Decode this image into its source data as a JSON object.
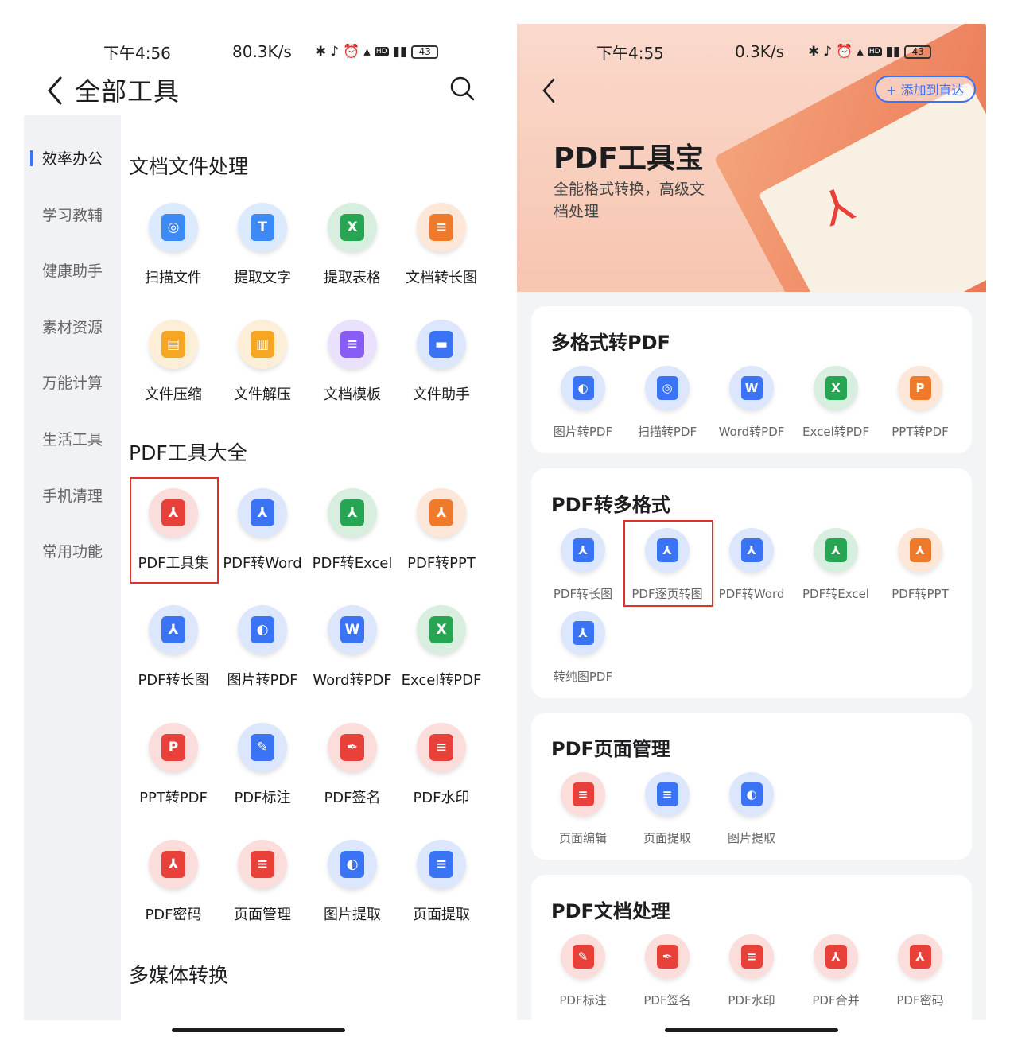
{
  "left": {
    "status": {
      "time": "下午4:56",
      "net": "80.3K/s",
      "battery": "43"
    },
    "title": "全部工具",
    "sidebar": [
      {
        "label": "效率办公"
      },
      {
        "label": "学习教辅"
      },
      {
        "label": "健康助手"
      },
      {
        "label": "素材资源"
      },
      {
        "label": "万能计算"
      },
      {
        "label": "生活工具"
      },
      {
        "label": "手机清理"
      },
      {
        "label": "常用功能"
      }
    ],
    "sections": [
      {
        "title": "文档文件处理",
        "tools": [
          {
            "label": "扫描文件",
            "icon": "scan-icon",
            "color": "#3b8af5",
            "glyph": "◎"
          },
          {
            "label": "提取文字",
            "icon": "text-extract-icon",
            "color": "#3b8af5",
            "glyph": "T"
          },
          {
            "label": "提取表格",
            "icon": "excel-icon",
            "color": "#27a552",
            "glyph": "X"
          },
          {
            "label": "文档转长图",
            "icon": "doc-image-icon",
            "color": "#f07a2c",
            "glyph": "≡"
          },
          {
            "label": "文件压缩",
            "icon": "zip-icon",
            "color": "#f5a623",
            "glyph": "▤"
          },
          {
            "label": "文件解压",
            "icon": "unzip-icon",
            "color": "#f5a623",
            "glyph": "▥"
          },
          {
            "label": "文档模板",
            "icon": "template-icon",
            "color": "#8a5cf6",
            "glyph": "≡"
          },
          {
            "label": "文件助手",
            "icon": "folder-icon",
            "color": "#3b73f5",
            "glyph": "▬"
          }
        ]
      },
      {
        "title": "PDF工具大全",
        "tools": [
          {
            "label": "PDF工具集",
            "icon": "pdf-toolkit-icon",
            "color": "#e8413a",
            "glyph": "⅄"
          },
          {
            "label": "PDF转Word",
            "icon": "pdf-word-icon",
            "color": "#3b73f5",
            "glyph": "⅄"
          },
          {
            "label": "PDF转Excel",
            "icon": "pdf-excel-icon",
            "color": "#27a552",
            "glyph": "⅄"
          },
          {
            "label": "PDF转PPT",
            "icon": "pdf-ppt-icon",
            "color": "#f07a2c",
            "glyph": "⅄"
          },
          {
            "label": "PDF转长图",
            "icon": "pdf-longimage-icon",
            "color": "#3b73f5",
            "glyph": "⅄"
          },
          {
            "label": "图片转PDF",
            "icon": "image-pdf-icon",
            "color": "#3b73f5",
            "glyph": "◐"
          },
          {
            "label": "Word转PDF",
            "icon": "word-pdf-icon",
            "color": "#3b73f5",
            "glyph": "W"
          },
          {
            "label": "Excel转PDF",
            "icon": "excel-pdf-icon",
            "color": "#27a552",
            "glyph": "X"
          },
          {
            "label": "PPT转PDF",
            "icon": "ppt-pdf-icon",
            "color": "#e8413a",
            "glyph": "P"
          },
          {
            "label": "PDF标注",
            "icon": "annotate-icon",
            "color": "#3b73f5",
            "glyph": "✎"
          },
          {
            "label": "PDF签名",
            "icon": "signature-icon",
            "color": "#e8413a",
            "glyph": "✒"
          },
          {
            "label": "PDF水印",
            "icon": "watermark-icon",
            "color": "#e8413a",
            "glyph": "≡"
          },
          {
            "label": "PDF密码",
            "icon": "password-icon",
            "color": "#e8413a",
            "glyph": "⅄"
          },
          {
            "label": "页面管理",
            "icon": "page-manage-icon",
            "color": "#e8413a",
            "glyph": "≡"
          },
          {
            "label": "图片提取",
            "icon": "image-extract-icon",
            "color": "#3b73f5",
            "glyph": "◐"
          },
          {
            "label": "页面提取",
            "icon": "page-extract-icon",
            "color": "#3b73f5",
            "glyph": "≡"
          }
        ]
      },
      {
        "title": "多媒体转换",
        "tools": []
      }
    ]
  },
  "right": {
    "status": {
      "time": "下午4:55",
      "net": "0.3K/s",
      "battery": "43"
    },
    "add_button": "+ 添加到直达",
    "hero_title": "PDF工具宝",
    "hero_subtitle": "全能格式转换，高级文档处理",
    "cards": [
      {
        "title": "多格式转PDF",
        "tools": [
          {
            "label": "图片转PDF",
            "icon": "image-pdf-icon",
            "color": "#3b73f5",
            "glyph": "◐"
          },
          {
            "label": "扫描转PDF",
            "icon": "scan-pdf-icon",
            "color": "#3b73f5",
            "glyph": "◎"
          },
          {
            "label": "Word转PDF",
            "icon": "word-pdf-icon",
            "color": "#3b73f5",
            "glyph": "W"
          },
          {
            "label": "Excel转PDF",
            "icon": "excel-pdf-icon",
            "color": "#27a552",
            "glyph": "X"
          },
          {
            "label": "PPT转PDF",
            "icon": "ppt-pdf-icon",
            "color": "#f07a2c",
            "glyph": "P"
          }
        ]
      },
      {
        "title": "PDF转多格式",
        "tools": [
          {
            "label": "PDF转长图",
            "icon": "pdf-longimage-icon",
            "color": "#3b73f5",
            "glyph": "⅄"
          },
          {
            "label": "PDF逐页转图",
            "icon": "pdf-page-image-icon",
            "color": "#3b73f5",
            "glyph": "⅄"
          },
          {
            "label": "PDF转Word",
            "icon": "pdf-word-icon",
            "color": "#3b73f5",
            "glyph": "⅄"
          },
          {
            "label": "PDF转Excel",
            "icon": "pdf-excel-icon",
            "color": "#27a552",
            "glyph": "⅄"
          },
          {
            "label": "PDF转PPT",
            "icon": "pdf-ppt-icon",
            "color": "#f07a2c",
            "glyph": "⅄"
          },
          {
            "label": "转纯图PDF",
            "icon": "pure-image-pdf-icon",
            "color": "#3b73f5",
            "glyph": "⅄"
          }
        ]
      },
      {
        "title": "PDF页面管理",
        "tools": [
          {
            "label": "页面编辑",
            "icon": "page-edit-icon",
            "color": "#e8413a",
            "glyph": "≡"
          },
          {
            "label": "页面提取",
            "icon": "page-extract-icon",
            "color": "#3b73f5",
            "glyph": "≡"
          },
          {
            "label": "图片提取",
            "icon": "image-extract-icon",
            "color": "#3b73f5",
            "glyph": "◐"
          }
        ]
      },
      {
        "title": "PDF文档处理",
        "tools": [
          {
            "label": "PDF标注",
            "icon": "annotate-icon",
            "color": "#e8413a",
            "glyph": "✎"
          },
          {
            "label": "PDF签名",
            "icon": "signature-icon",
            "color": "#e8413a",
            "glyph": "✒"
          },
          {
            "label": "PDF水印",
            "icon": "watermark-icon",
            "color": "#e8413a",
            "glyph": "≡"
          },
          {
            "label": "PDF合并",
            "icon": "merge-icon",
            "color": "#e8413a",
            "glyph": "⅄"
          },
          {
            "label": "PDF密码",
            "icon": "password-icon",
            "color": "#e8413a",
            "glyph": "⅄"
          }
        ]
      }
    ]
  }
}
